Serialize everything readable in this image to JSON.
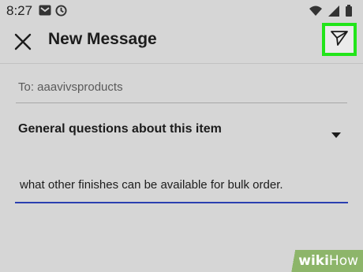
{
  "status_bar": {
    "time": "8:27",
    "left_icons": [
      "gmail-icon",
      "sync-icon"
    ],
    "right_icons": [
      "wifi-icon",
      "signal-icon",
      "battery-icon"
    ]
  },
  "app_bar": {
    "title": "New Message",
    "close_icon": "close-icon",
    "send_icon": "send-icon",
    "send_highlight_color": "#22e51a"
  },
  "form": {
    "to_label": "To: aaavivsproducts",
    "subject": "General questions about this item",
    "message": "what other finishes can be available for bulk order.",
    "underline_color": "#2b3fb0"
  },
  "watermark": {
    "brand_bold": "wiki",
    "brand_light": "How"
  }
}
